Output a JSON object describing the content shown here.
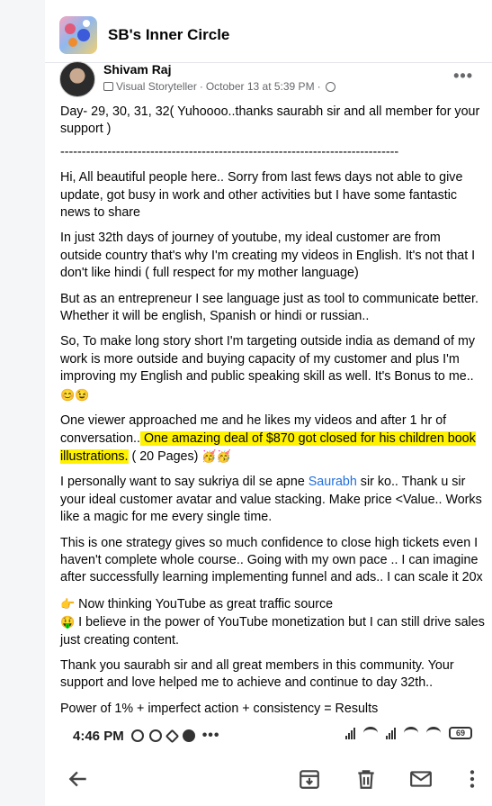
{
  "group": {
    "name": "SB's Inner Circle"
  },
  "post": {
    "author": "Shivam Raj",
    "badge": "Visual Storyteller",
    "date": "October 13 at 5:39 PM",
    "paragraphs": {
      "p1": "Day- 29, 30, 31, 32(  Yuhoooo..thanks saurabh sir and all member for your support )",
      "dashes": "-------------------------------------------------------------------------------",
      "p2": "Hi, All beautiful people here.. Sorry from last fews days not able to give update, got busy in work and other activities but I have some fantastic news to share",
      "p3": "In just 32th days of journey of youtube, my ideal customer are from outside country that's why I'm creating my videos in English.  It's not that I don't like hindi ( full respect for my mother language)",
      "p4": "But as an entrepreneur I see language just as tool to communicate better. Whether it will be english, Spanish or hindi or russian..",
      "p5": "So, To make long story short I'm targeting outside india as demand of my work is more outside and buying capacity of my customer and plus I'm improving my English and public speaking skill as well. It's Bonus to me..",
      "p5_emoji": "😊😉",
      "p6_before": "One viewer approached me and he likes my videos and after 1 hr of conversation..",
      "p6_highlight": " One amazing deal of $870 got closed for his children book illustrations.",
      "p6_after": " ( 20 Pages) ",
      "p6_emoji": "🥳🥳",
      "p7_before": "I personally want to say sukriya dil se apne ",
      "p7_link": "Saurabh",
      "p7_after": " sir ko.. Thank u sir your ideal customer avatar and value stacking. Make price <Value.. Works like a magic for me every single time.",
      "p8": "This is one strategy gives so much confidence to close high tickets even I haven't complete whole course.. Going with my own pace .. I can imagine after successfully learning implementing funnel and ads.. I can scale it 20x",
      "p9_emoji": "👉",
      "p9": " Now thinking YouTube as great traffic source",
      "p10_emoji": "🤑",
      "p10": " I believe in the power of YouTube monetization but I can still drive sales just creating content.",
      "p11": "Thank you saurabh sir and all great members in this community. Your support and love helped me to achieve and continue to day 32th..",
      "p12": "Power of 1% + imperfect action + consistency = Results"
    }
  },
  "status_bar": {
    "time": "4:46 PM",
    "battery": "69"
  },
  "colors": {
    "highlight": "#fff200",
    "link": "#216fdb"
  },
  "icons": [
    "group-avatar",
    "shield-badge-icon",
    "globe-icon",
    "more-icon",
    "back-arrow-icon",
    "archive-icon",
    "delete-icon",
    "mail-icon",
    "kebab-menu-icon"
  ]
}
